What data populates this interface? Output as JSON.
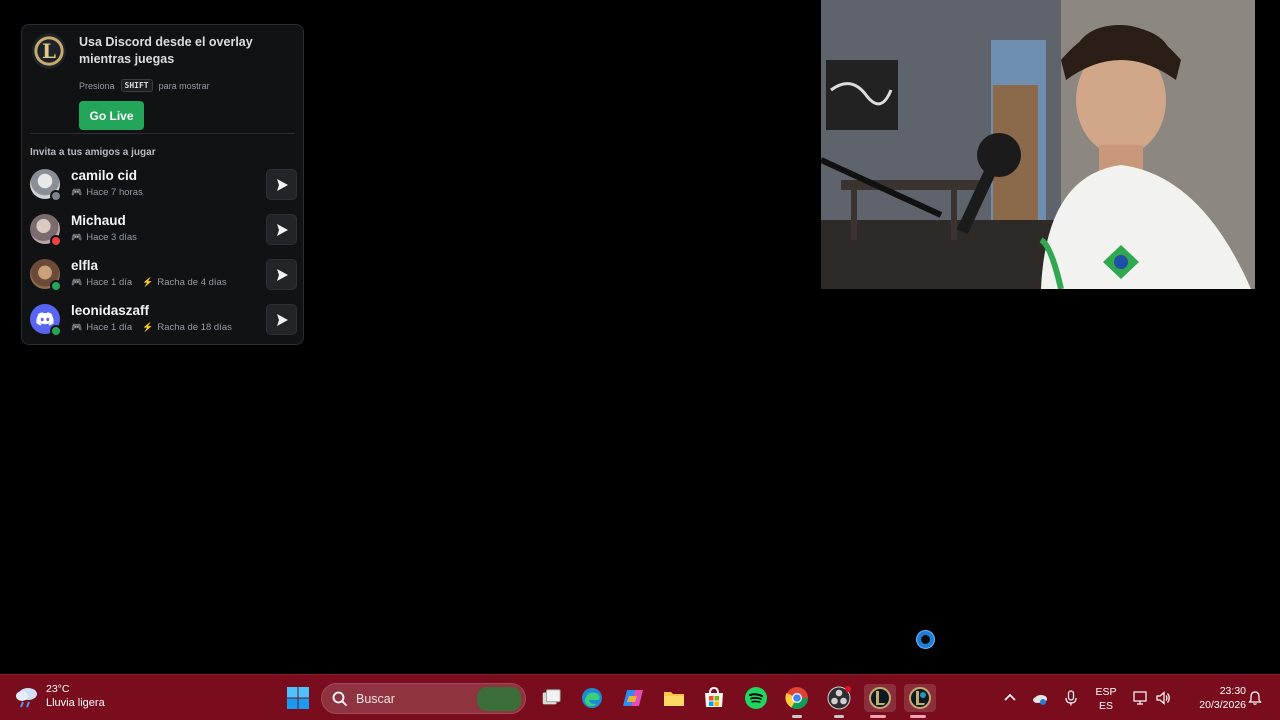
{
  "overlay": {
    "title": "Usa Discord desde el overlay mientras juegas",
    "hint_prefix": "Presiona",
    "hint_key": "SHIFT",
    "hint_suffix": "para mostrar",
    "go_live_label": "Go Live",
    "invite_title": "Invita a tus amigos a jugar",
    "friends": [
      {
        "name": "camilo cid",
        "last_played": "Hace 7 horas",
        "streak": "",
        "status": "offline",
        "status_color": "#80848e"
      },
      {
        "name": "Michaud",
        "last_played": "Hace 3 días",
        "streak": "",
        "status": "dnd",
        "status_color": "#f23f43"
      },
      {
        "name": "elfla",
        "last_played": "Hace 1 día",
        "streak": "Racha de 4 días",
        "status": "online",
        "status_color": "#23a55a"
      },
      {
        "name": "leonidaszaff",
        "last_played": "Hace 1 día",
        "streak": "Racha de 18 días",
        "status": "online",
        "status_color": "#23a55a"
      }
    ]
  },
  "taskbar": {
    "weather_temp": "23°C",
    "weather_desc": "Lluvia ligera",
    "search_placeholder": "Buscar",
    "lang_top": "ESP",
    "lang_bottom": "ES",
    "time": "23:30",
    "date": "20/3/2026",
    "pinned_icons": [
      "windows-start-icon",
      "search-icon",
      "task-view-icon",
      "edge-icon",
      "copilot-icon",
      "file-explorer-icon",
      "microsoft-store-icon",
      "spotify-icon",
      "chrome-icon",
      "obs-icon",
      "league-client-icon",
      "league-game-icon"
    ]
  },
  "colors": {
    "taskbar_bg": "#7a0d1d",
    "overlay_bg": "#111214",
    "go_live": "#23a55a",
    "spinner": "#1f7fd6"
  }
}
